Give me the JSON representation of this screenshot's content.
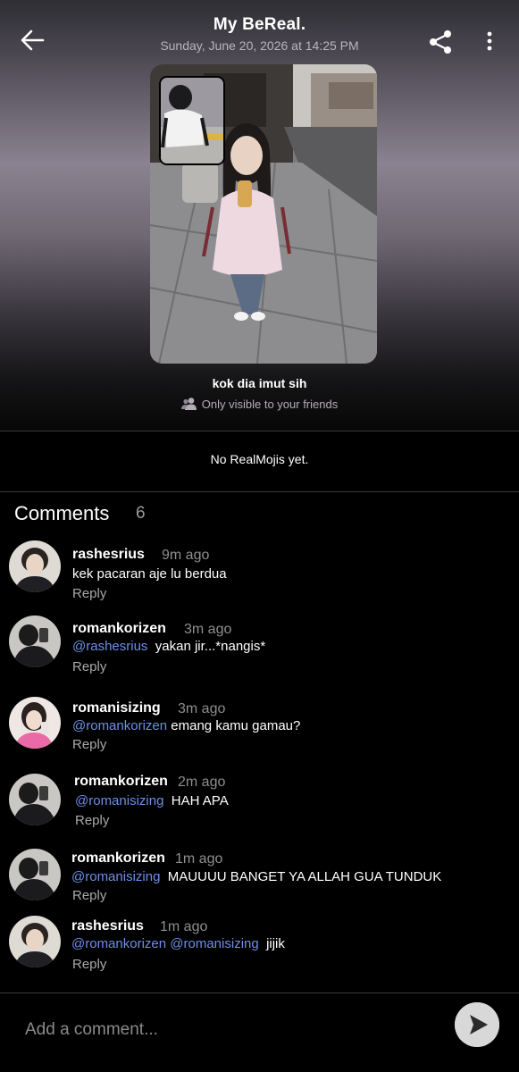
{
  "header": {
    "title": "My BeReal.",
    "subtitle": "Sunday, June 20, 2026 at 14:25 PM",
    "back_icon": "arrow-left-icon",
    "share_icon": "share-icon",
    "more_icon": "more-vertical-icon"
  },
  "post": {
    "caption": "kok dia imut sih",
    "visibility": "Only visible to your friends",
    "visibility_icon": "friends-icon"
  },
  "realmojis": {
    "empty_text": "No RealMojis yet."
  },
  "comments": {
    "heading": "Comments",
    "count": "6",
    "items": [
      {
        "user": "rashesrius",
        "time": "9m ago",
        "mentions": [],
        "text": "kek pacaran aje lu berdua",
        "reply": "Reply"
      },
      {
        "user": "romankorizen",
        "time": "3m ago",
        "mentions": [
          "@rashesrius"
        ],
        "text": "yakan jir...*nangis*",
        "reply": "Reply"
      },
      {
        "user": "romanisizing",
        "time": "3m ago",
        "mentions": [
          "@romankorizen"
        ],
        "text": "emang kamu gamau?",
        "reply": "Reply"
      },
      {
        "user": "romankorizen",
        "time": "2m ago",
        "mentions": [
          "@romanisizing"
        ],
        "text": "HAH APA",
        "reply": "Reply"
      },
      {
        "user": "romankorizen",
        "time": "1m ago",
        "mentions": [
          "@romanisizing"
        ],
        "text": "MAUUUU BANGET YA ALLAH GUA TUNDUK",
        "reply": "Reply"
      },
      {
        "user": "rashesrius",
        "time": "1m ago",
        "mentions": [
          "@romankorizen",
          "@romanisizing"
        ],
        "text": "jijik",
        "reply": "Reply"
      }
    ]
  },
  "composer": {
    "placeholder": "Add a comment...",
    "send_icon": "send-icon"
  },
  "colors": {
    "mention": "#6d8fe6",
    "background": "#000000",
    "muted": "#8e8e8e"
  }
}
